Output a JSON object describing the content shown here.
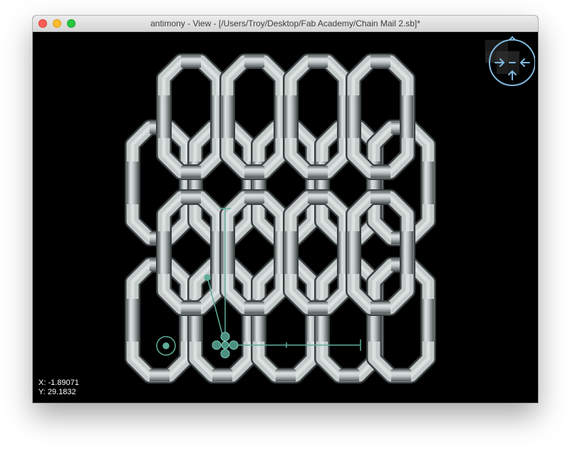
{
  "window": {
    "title": "antimony - View - [/Users/Troy/Desktop/Fab Academy/Chain Mail 2.sb]*"
  },
  "coords": {
    "x": "X: -1.89071",
    "y": "Y: 29.1832"
  },
  "colors": {
    "background": "#000000",
    "ring": "#c3c9c9",
    "handles": "#5fae9a"
  },
  "icons": {
    "close": "close-button",
    "minimize": "minimize-button",
    "maximize": "zoom-button",
    "navigator": "view-navigator-icon"
  }
}
